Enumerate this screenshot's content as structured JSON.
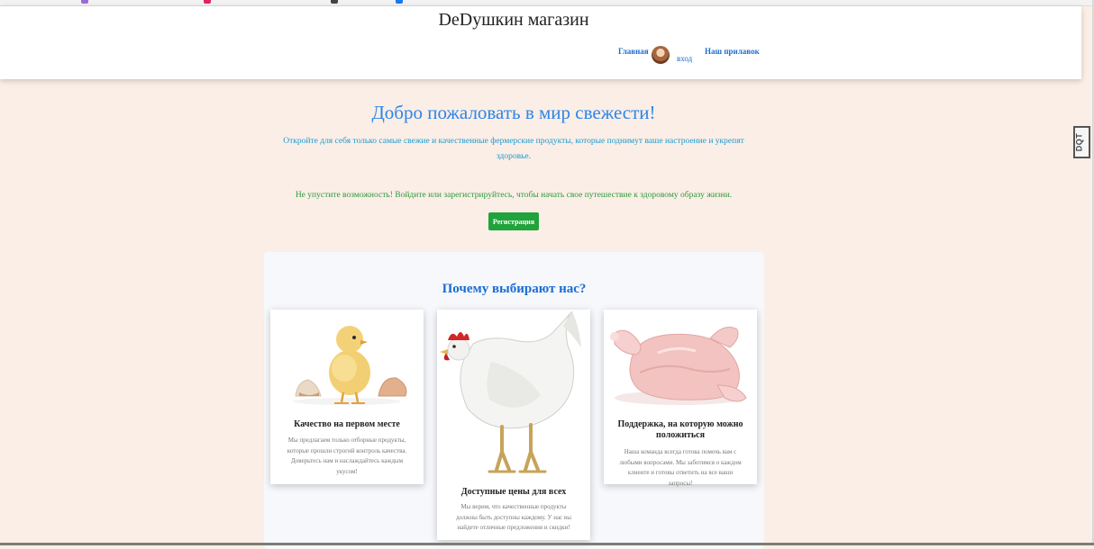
{
  "header": {
    "site_title": "DeDушкин магазин",
    "nav": {
      "home": "Главная",
      "login": "вход",
      "stall": "Наш прилавок"
    }
  },
  "side_tab": {
    "label": "DQT"
  },
  "hero": {
    "title": "Добро пожаловать в мир свежести!",
    "subtitle": "Откройте для себя только самые свежие и качественные фермерские продукты, которые поднимут ваше настроение и укрепят здоровье.",
    "cta_text": "Не упустите возможность! Войдите или зарегистрируйтесь, чтобы начать свое путешествие к здоровому образу жизни.",
    "register_label": "Регистрация"
  },
  "why": {
    "title": "Почему выбирают нас?",
    "cards": [
      {
        "image": "chick-icon",
        "title": "Качество на первом месте",
        "text": "Мы предлагаем только отборные продукты, которые прошли строгий контроль качества. Доверьтесь нам и наслаждайтесь каждым укусом!"
      },
      {
        "image": "hen-icon",
        "title": "Доступные цены для всех",
        "text": "Мы верим, что качественные продукты должны быть доступны каждому. У нас вы найдете отличные предложения и скидки!"
      },
      {
        "image": "raw-chicken-icon",
        "title": "Поддержка, на которую можно положиться",
        "text": "Наша команда всегда готова помочь вам с любыми вопросами. Мы заботимся о каждом клиенте и готовы ответить на все ваши запросы!"
      }
    ]
  },
  "colors": {
    "page_bg": "#faeee6",
    "title_blue": "#2d86e8",
    "subtitle_cyan": "#1f9acf",
    "cta_green": "#2f9a3f",
    "button_green": "#21a33c"
  }
}
